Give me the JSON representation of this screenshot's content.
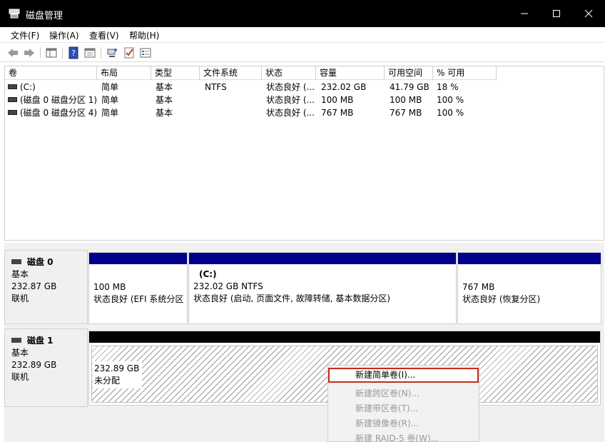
{
  "window": {
    "title": "磁盘管理",
    "min_glyph": "—",
    "close_glyph": "✕"
  },
  "menu": [
    "文件(F)",
    "操作(A)",
    "查看(V)",
    "帮助(H)"
  ],
  "toolbar": {
    "icons": [
      "back-arrow-icon",
      "forward-arrow-icon",
      "show-hide-tree-icon",
      "help-icon",
      "properties-icon",
      "connect-icon",
      "check-icon",
      "list-icon"
    ]
  },
  "volume_list": {
    "columns": [
      "卷",
      "布局",
      "类型",
      "文件系统",
      "状态",
      "容量",
      "可用空间",
      "% 可用"
    ],
    "rows": [
      [
        "(C:)",
        "简单",
        "基本",
        "NTFS",
        "状态良好 (...",
        "232.02 GB",
        "41.79 GB",
        "18 %"
      ],
      [
        "(磁盘 0 磁盘分区 1)",
        "简单",
        "基本",
        "",
        "状态良好 (...",
        "100 MB",
        "100 MB",
        "100 %"
      ],
      [
        "(磁盘 0 磁盘分区 4)",
        "简单",
        "基本",
        "",
        "状态良好 (...",
        "767 MB",
        "767 MB",
        "100 %"
      ]
    ]
  },
  "disks": {
    "disk0": {
      "name": "磁盘 0",
      "type": "基本",
      "size": "232.87 GB",
      "state": "联机",
      "partitions": [
        {
          "title": "",
          "size": "100 MB",
          "status": "状态良好 (EFI 系统分区"
        },
        {
          "title": "(C:)",
          "size": "232.02 GB NTFS",
          "status": "状态良好 (启动, 页面文件, 故障转储, 基本数据分区)"
        },
        {
          "title": "",
          "size": "767 MB",
          "status": "状态良好 (恢复分区)"
        }
      ]
    },
    "disk1": {
      "name": "磁盘 1",
      "type": "基本",
      "size": "232.89 GB",
      "state": "联机",
      "unallocated": {
        "size": "232.89 GB",
        "label": "未分配"
      }
    }
  },
  "context_menu": {
    "items": [
      "新建简单卷(I)...",
      "新建跨区卷(N)...",
      "新建带区卷(T)...",
      "新建镜像卷(R)...",
      "新建 RAID-5 卷(W)..."
    ],
    "highlight_color": "#c42b1c"
  },
  "colors": {
    "partition_bar": "#00008b",
    "unallocated_bar": "#000000",
    "titlebar": "#000000"
  }
}
